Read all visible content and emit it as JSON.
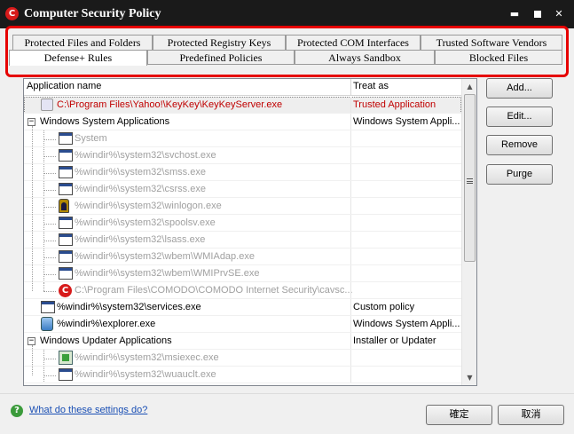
{
  "window": {
    "title": "Computer Security Policy",
    "app_icon_letter": "C",
    "controls": {
      "minimize": "▬",
      "close": "✕"
    }
  },
  "tabs": {
    "row1": [
      "Protected Files and Folders",
      "Protected Registry Keys",
      "Protected COM Interfaces",
      "Trusted Software Vendors"
    ],
    "row2": [
      "Defense+ Rules",
      "Predefined Policies",
      "Always Sandbox",
      "Blocked Files"
    ],
    "selected": "Defense+ Rules",
    "highlight_color": "#e60000"
  },
  "list": {
    "columns": {
      "name": "Application name",
      "treat": "Treat as"
    },
    "rows": [
      {
        "name": "C:\\Program Files\\Yahoo!\\KeyKey\\KeyKeyServer.exe",
        "treat": "Trusted Application",
        "icon": "keykey-icon"
      },
      {
        "name": "Windows System Applications",
        "treat": "Windows System Appli...",
        "expander": "−"
      },
      {
        "name": "System",
        "treat": "",
        "icon": "window-icon"
      },
      {
        "name": "%windir%\\system32\\svchost.exe",
        "treat": "",
        "icon": "window-icon"
      },
      {
        "name": "%windir%\\system32\\smss.exe",
        "treat": "",
        "icon": "window-icon"
      },
      {
        "name": "%windir%\\system32\\csrss.exe",
        "treat": "",
        "icon": "window-icon"
      },
      {
        "name": "%windir%\\system32\\winlogon.exe",
        "treat": "",
        "icon": "winlogon-icon"
      },
      {
        "name": "%windir%\\system32\\spoolsv.exe",
        "treat": "",
        "icon": "window-icon"
      },
      {
        "name": "%windir%\\system32\\lsass.exe",
        "treat": "",
        "icon": "window-icon"
      },
      {
        "name": "%windir%\\system32\\wbem\\WMIAdap.exe",
        "treat": "",
        "icon": "window-icon"
      },
      {
        "name": "%windir%\\system32\\wbem\\WMIPrvSE.exe",
        "treat": "",
        "icon": "window-icon"
      },
      {
        "name": "C:\\Program Files\\COMODO\\COMODO Internet Security\\cavsc...",
        "treat": "",
        "icon": "comodo-icon"
      },
      {
        "name": "%windir%\\system32\\services.exe",
        "treat": "Custom policy",
        "icon": "window-icon"
      },
      {
        "name": "%windir%\\explorer.exe",
        "treat": "Windows System Appli...",
        "icon": "explorer-icon"
      },
      {
        "name": "Windows Updater Applications",
        "treat": "Installer or Updater",
        "expander": "−"
      },
      {
        "name": "%windir%\\system32\\msiexec.exe",
        "treat": "",
        "icon": "msiexec-icon"
      },
      {
        "name": "%windir%\\system32\\wuauclt.exe",
        "treat": "",
        "icon": "window-icon"
      }
    ],
    "scroll": {
      "up": "▲",
      "down": "▼"
    }
  },
  "buttons": {
    "add": "Add...",
    "edit": "Edit...",
    "remove": "Remove",
    "purge": "Purge",
    "ok": "確定",
    "cancel": "取消"
  },
  "help": {
    "icon_letter": "?",
    "link": "What do these settings do?"
  }
}
